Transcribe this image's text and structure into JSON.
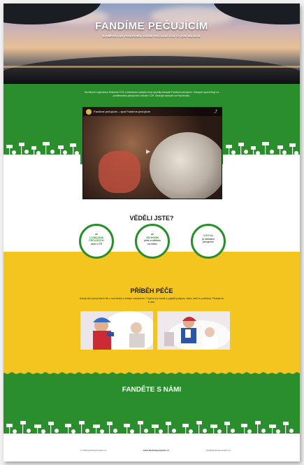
{
  "hero": {
    "title": "FANDÍME PEČUJÍCÍM",
    "subtitle": "KAMPAŇ NA PODPORU OSOB PEČUJÍCÍCH O SVÉ BLÍZKÉ"
  },
  "intro": {
    "text": "Neziskové organizace Diakonie ČCE a Alzheimer nadační fond spustily kampaň Fandíme pečujícím. Kampaň upozorňuje na problematiku pečujících o blízké v ČR. Sledujte kampaň na Facebooku."
  },
  "video": {
    "title": "Fandíme pečujícím – spot Fandíme pečujícím",
    "share_label": "Share",
    "play_symbol": "▶"
  },
  "facts": {
    "heading": "VĚDĚLI JSTE?",
    "items": [
      {
        "line1": "až",
        "number": "1,3 MILIONU",
        "line2": "PEČUJÍCÍCH",
        "line3": "osob v ČR"
      },
      {
        "line1": "až",
        "number": "150 HODIN",
        "line2": "péče a dohledu",
        "line3": "za měsíc"
      },
      {
        "line1": "",
        "number": "3 870 Kč",
        "line2": "je standard",
        "line3": "pečujícího"
      }
    ]
  },
  "story": {
    "heading": "PŘÍBĚH PÉČE",
    "text": "Každý den pečují tisíce lidí o své blízké s velkým nasazením. Pojďme jim fandit a vyjádřit podporu všem, kteří to potřebují. Přidejte se k nám."
  },
  "join": {
    "heading": "FANDĚTE S NÁMI"
  },
  "footer": {
    "left": "© 2019 fandimepecujicim.cz",
    "center": "www.fandimepecujicim.cz",
    "right": "info@fandimepecujicim.cz"
  },
  "colors": {
    "green": "#2a8e2c",
    "yellow": "#f5c51f",
    "white": "#ffffff"
  }
}
